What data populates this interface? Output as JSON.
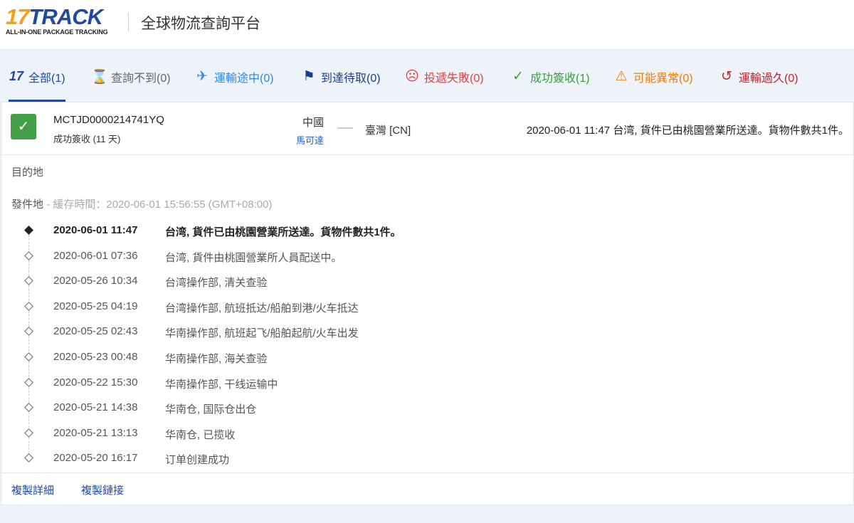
{
  "header": {
    "logo_num": "17",
    "logo_word": "TRACK",
    "logo_sub": "ALL-IN-ONE PACKAGE TRACKING",
    "title": "全球物流查詢平台"
  },
  "tabs": [
    {
      "label": "全部(1)",
      "icon": "17",
      "color": "#1f4aa0"
    },
    {
      "label": "查詢不到(0)",
      "icon": "⌛",
      "color": "#666666"
    },
    {
      "label": "運輸途中(0)",
      "icon": "✈",
      "color": "#2e8ae6"
    },
    {
      "label": "到達待取(0)",
      "icon": "⚑",
      "color": "#1a3f8f"
    },
    {
      "label": "投遞失敗(0)",
      "icon": "☹",
      "color": "#e64340"
    },
    {
      "label": "成功簽收(1)",
      "icon": "✓",
      "color": "#3a9d3a"
    },
    {
      "label": "可能異常(0)",
      "icon": "⚠",
      "color": "#f07d00"
    },
    {
      "label": "運輸過久(0)",
      "icon": "↺",
      "color": "#c0262d"
    }
  ],
  "shipment": {
    "number": "MCTJD0000214741YQ",
    "status": "成功簽收 (11 天)",
    "origin": "中國",
    "carrier": "馬可達",
    "destination": "臺灣 [CN]",
    "latest": "2020-06-01 11:47  台湾, 貨件已由桃園營業所送達。貨物件數共1件。"
  },
  "labels": {
    "destination": "目的地",
    "origin": "發件地",
    "cache": " - 緩存時間：2020-06-01 15:56:55 (GMT+08:00)"
  },
  "events": [
    {
      "date": "2020-06-01 11:47",
      "text": "台湾, 貨件已由桃園營業所送達。貨物件數共1件。"
    },
    {
      "date": "2020-06-01 07:36",
      "text": "台湾, 貨件由桃園營業所人員配送中。"
    },
    {
      "date": "2020-05-26 10:34",
      "text": "台湾操作部, 清关查验"
    },
    {
      "date": "2020-05-25 04:19",
      "text": "台湾操作部, 航班抵达/船舶到港/火车抵达"
    },
    {
      "date": "2020-05-25 02:43",
      "text": "华南操作部, 航班起飞/船舶起航/火车出发"
    },
    {
      "date": "2020-05-23 00:48",
      "text": "华南操作部, 海关查验"
    },
    {
      "date": "2020-05-22 15:30",
      "text": "华南操作部, 干线运输中"
    },
    {
      "date": "2020-05-21 14:38",
      "text": "华南仓, 国际仓出仓"
    },
    {
      "date": "2020-05-21 13:13",
      "text": "华南仓, 已揽收"
    },
    {
      "date": "2020-05-20 16:17",
      "text": "订单创建成功"
    }
  ],
  "footer": {
    "copy_details": "複製詳細",
    "copy_link": "複製鏈接"
  }
}
